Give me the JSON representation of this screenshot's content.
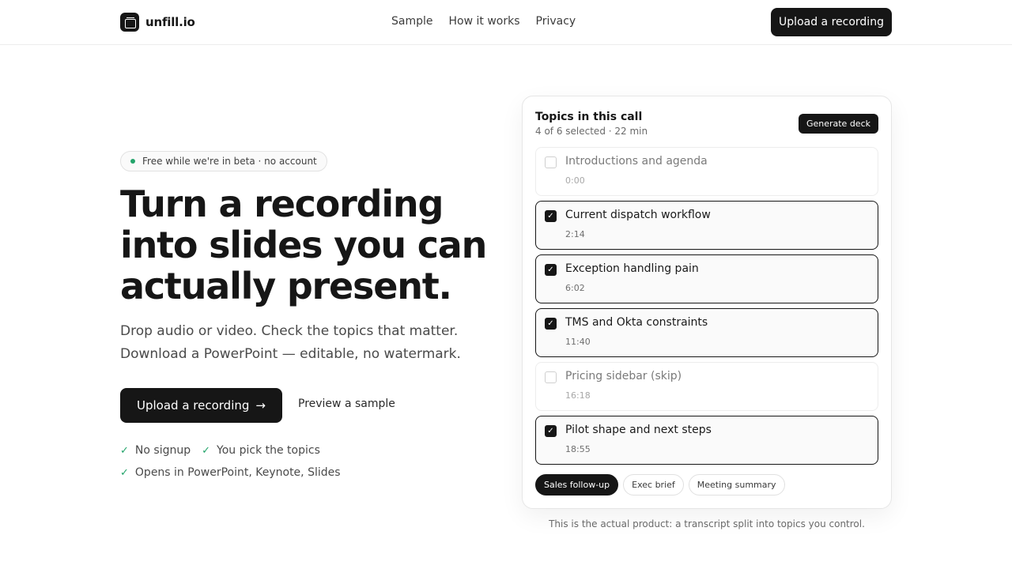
{
  "brand": {
    "name": "unfill.io",
    "icon": "app-logo-icon"
  },
  "nav": {
    "items": [
      "Sample",
      "How it works",
      "Privacy"
    ]
  },
  "header": {
    "cta_label": "Upload a recording"
  },
  "hero": {
    "badge": "Free while we're in beta · no account",
    "title": "Turn a recording into slides you can actually present.",
    "subtitle": "Drop audio or video. Check the topics that matter. Download a PowerPoint — editable, no watermark.",
    "primary_cta": "Upload a recording",
    "secondary_cta": "Preview a sample",
    "checks": [
      "No signup",
      "You pick the topics",
      "Opens in PowerPoint, Keynote, Slides"
    ]
  },
  "card": {
    "title": "Topics in this call",
    "meta": "4 of 6 selected · 22 min",
    "generate_label": "Generate deck",
    "topics": [
      {
        "label": "Introductions and agenda",
        "time": "0:00",
        "selected": false
      },
      {
        "label": "Current dispatch workflow",
        "time": "2:14",
        "selected": true
      },
      {
        "label": "Exception handling pain",
        "time": "6:02",
        "selected": true
      },
      {
        "label": "TMS and Okta constraints",
        "time": "11:40",
        "selected": true
      },
      {
        "label": "Pricing sidebar (skip)",
        "time": "16:18",
        "selected": false
      },
      {
        "label": "Pilot shape and next steps",
        "time": "18:55",
        "selected": true
      }
    ],
    "presets": [
      {
        "label": "Sales follow-up",
        "active": true
      },
      {
        "label": "Exec brief",
        "active": false
      },
      {
        "label": "Meeting summary",
        "active": false
      }
    ]
  },
  "caption": "This is the actual product: a transcript split into topics you control.",
  "colors": {
    "accent": "#161616",
    "success": "#23a46a"
  }
}
